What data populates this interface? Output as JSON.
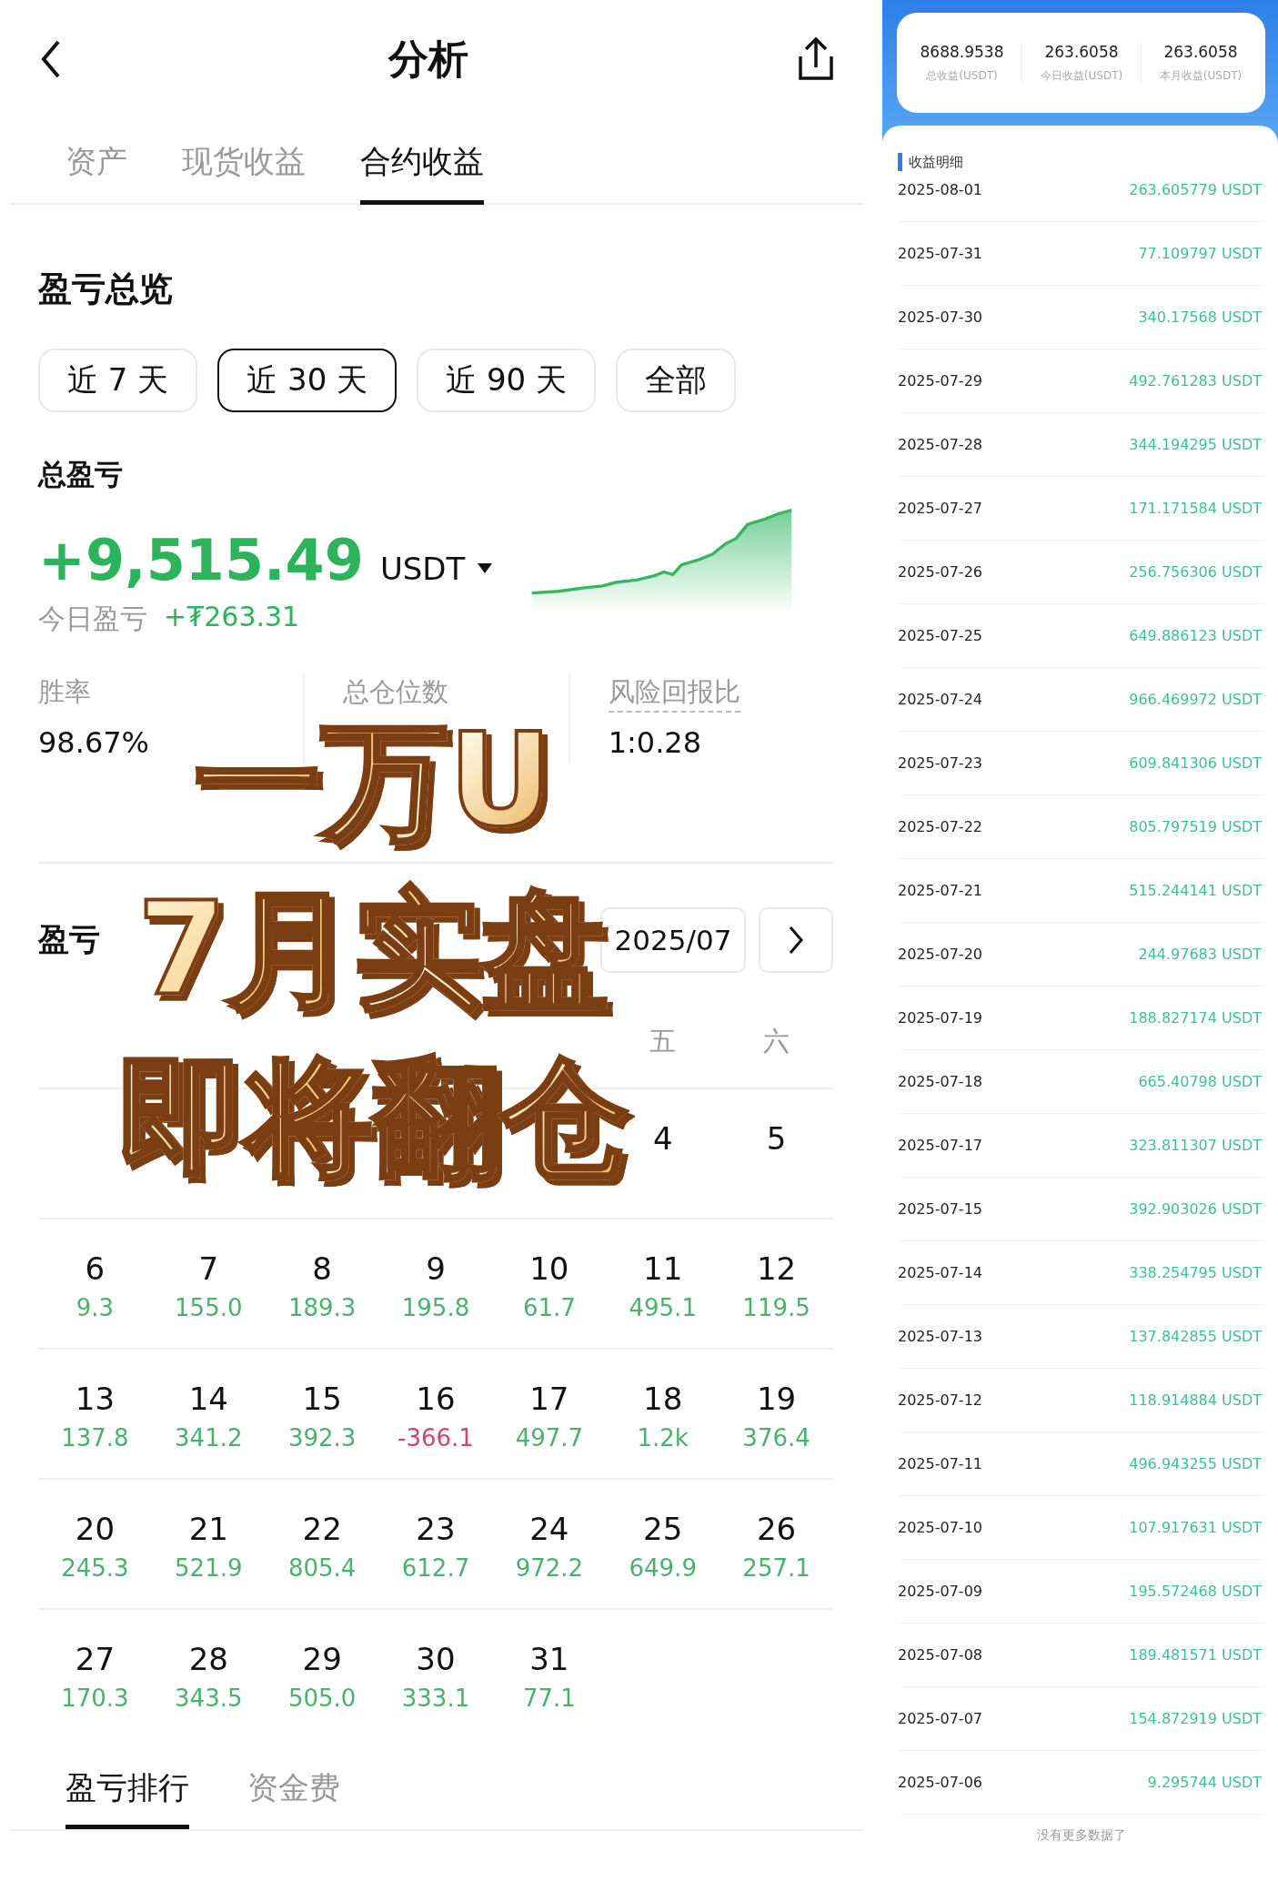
{
  "header": {
    "title": "分析"
  },
  "tabs": [
    {
      "label": "资产",
      "selected": false
    },
    {
      "label": "现货收益",
      "selected": false
    },
    {
      "label": "合约收益",
      "selected": true
    }
  ],
  "overview": {
    "title": "盈亏总览",
    "ranges": [
      {
        "label": "近 7 天",
        "selected": false
      },
      {
        "label": "近 30 天",
        "selected": true
      },
      {
        "label": "近 90 天",
        "selected": false
      },
      {
        "label": "全部",
        "selected": false
      }
    ],
    "total": {
      "label": "总盈亏",
      "value": "+9,515.49",
      "unit": "USDT",
      "today_label": "今日盈亏",
      "today_value": "+₮263.31"
    },
    "stats": [
      {
        "label": "胜率",
        "value": "98.67%",
        "dashed": false
      },
      {
        "label": "总仓位数",
        "dashed": false
      },
      {
        "label": "风险回报比",
        "value": "1:0.28",
        "dashed": true
      }
    ]
  },
  "calendar": {
    "title": "盈亏",
    "month": "2025/07",
    "weekdays": [
      "五",
      "六"
    ],
    "weeks": [
      [
        {
          "day": "4"
        },
        {
          "day": "5"
        }
      ],
      [
        {
          "day": "6",
          "pnl": "9.3",
          "negative": false
        },
        {
          "day": "7",
          "pnl": "155.0",
          "negative": false
        },
        {
          "day": "8",
          "pnl": "189.3",
          "negative": false
        },
        {
          "day": "9",
          "pnl": "195.8",
          "negative": false
        },
        {
          "day": "10",
          "pnl": "61.7",
          "negative": false
        },
        {
          "day": "11",
          "pnl": "495.1",
          "negative": false
        },
        {
          "day": "12",
          "pnl": "119.5",
          "negative": false
        }
      ],
      [
        {
          "day": "13",
          "pnl": "137.8",
          "negative": false
        },
        {
          "day": "14",
          "pnl": "341.2",
          "negative": false
        },
        {
          "day": "15",
          "pnl": "392.3",
          "negative": false
        },
        {
          "day": "16",
          "pnl": "-366.1",
          "negative": true
        },
        {
          "day": "17",
          "pnl": "497.7",
          "negative": false
        },
        {
          "day": "18",
          "pnl": "1.2k",
          "negative": false
        },
        {
          "day": "19",
          "pnl": "376.4",
          "negative": false
        }
      ],
      [
        {
          "day": "20",
          "pnl": "245.3",
          "negative": false
        },
        {
          "day": "21",
          "pnl": "521.9",
          "negative": false
        },
        {
          "day": "22",
          "pnl": "805.4",
          "negative": false
        },
        {
          "day": "23",
          "pnl": "612.7",
          "negative": false
        },
        {
          "day": "24",
          "pnl": "972.2",
          "negative": false
        },
        {
          "day": "25",
          "pnl": "649.9",
          "negative": false
        },
        {
          "day": "26",
          "pnl": "257.1",
          "negative": false
        }
      ],
      [
        {
          "day": "27",
          "pnl": "170.3",
          "negative": false
        },
        {
          "day": "28",
          "pnl": "343.5",
          "negative": false
        },
        {
          "day": "29",
          "pnl": "505.0",
          "negative": false
        },
        {
          "day": "30",
          "pnl": "333.1",
          "negative": false
        },
        {
          "day": "31",
          "pnl": "77.1",
          "negative": false
        }
      ]
    ]
  },
  "bottom_tabs": [
    {
      "label": "盈亏排行",
      "selected": true
    },
    {
      "label": "资金费",
      "selected": false
    }
  ],
  "overlay": {
    "lines": [
      "一万U",
      "7月实盘",
      "即将翻仓"
    ]
  },
  "income": {
    "summary": [
      {
        "value": "8688.9538",
        "label": "总收益(USDT)"
      },
      {
        "value": "263.6058",
        "label": "今日收益(USDT)"
      },
      {
        "value": "263.6058",
        "label": "本月收益(USDT)"
      }
    ],
    "title": "收益明细",
    "rows": [
      {
        "date": "2025-08-01",
        "amount": "263.605779 USDT"
      },
      {
        "date": "2025-07-31",
        "amount": "77.109797 USDT"
      },
      {
        "date": "2025-07-30",
        "amount": "340.17568 USDT"
      },
      {
        "date": "2025-07-29",
        "amount": "492.761283 USDT"
      },
      {
        "date": "2025-07-28",
        "amount": "344.194295 USDT"
      },
      {
        "date": "2025-07-27",
        "amount": "171.171584 USDT"
      },
      {
        "date": "2025-07-26",
        "amount": "256.756306 USDT"
      },
      {
        "date": "2025-07-25",
        "amount": "649.886123 USDT"
      },
      {
        "date": "2025-07-24",
        "amount": "966.469972 USDT"
      },
      {
        "date": "2025-07-23",
        "amount": "609.841306 USDT"
      },
      {
        "date": "2025-07-22",
        "amount": "805.797519 USDT"
      },
      {
        "date": "2025-07-21",
        "amount": "515.244141 USDT"
      },
      {
        "date": "2025-07-20",
        "amount": "244.97683 USDT"
      },
      {
        "date": "2025-07-19",
        "amount": "188.827174 USDT"
      },
      {
        "date": "2025-07-18",
        "amount": "665.40798 USDT"
      },
      {
        "date": "2025-07-17",
        "amount": "323.811307 USDT"
      },
      {
        "date": "2025-07-15",
        "amount": "392.903026 USDT"
      },
      {
        "date": "2025-07-14",
        "amount": "338.254795 USDT"
      },
      {
        "date": "2025-07-13",
        "amount": "137.842855 USDT"
      },
      {
        "date": "2025-07-12",
        "amount": "118.914884 USDT"
      },
      {
        "date": "2025-07-11",
        "amount": "496.943255 USDT"
      },
      {
        "date": "2025-07-10",
        "amount": "107.917631 USDT"
      },
      {
        "date": "2025-07-09",
        "amount": "195.572468 USDT"
      },
      {
        "date": "2025-07-08",
        "amount": "189.481571 USDT"
      },
      {
        "date": "2025-07-07",
        "amount": "154.872919 USDT"
      },
      {
        "date": "2025-07-06",
        "amount": "9.295744 USDT"
      }
    ],
    "footer": "没有更多数据了"
  }
}
